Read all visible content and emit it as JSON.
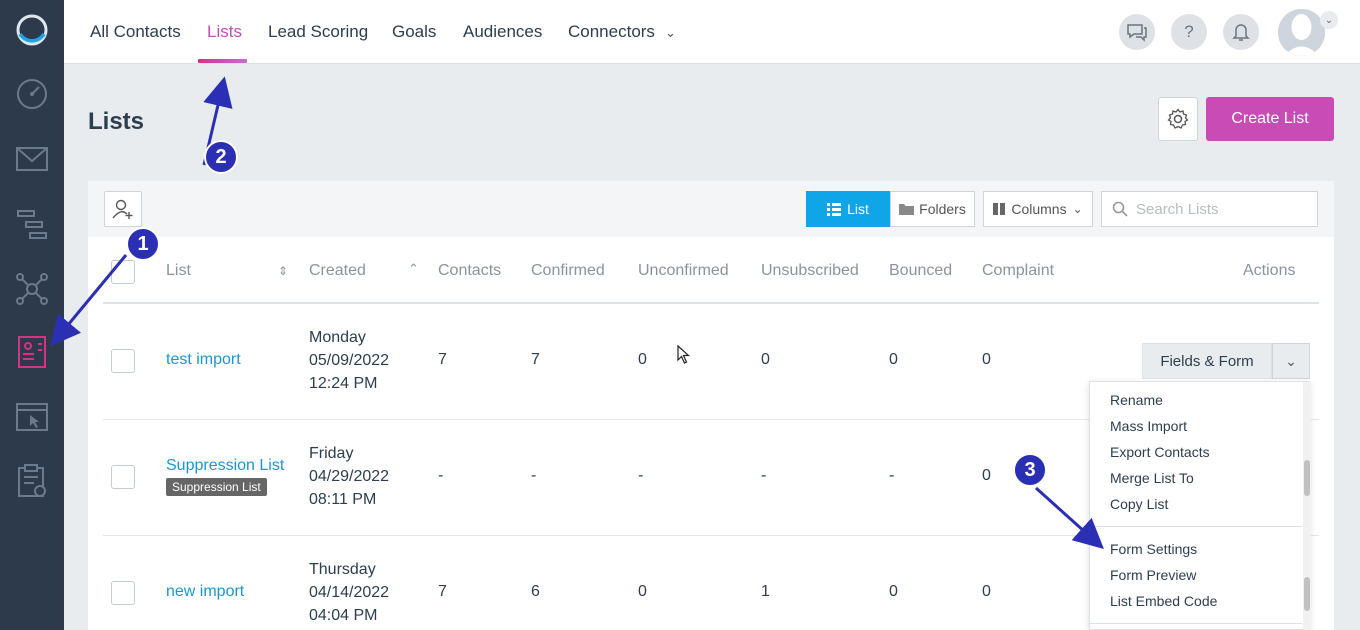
{
  "nav": {
    "items": [
      "All Contacts",
      "Lists",
      "Lead Scoring",
      "Goals",
      "Audiences",
      "Connectors"
    ],
    "active": "Lists",
    "help_label": "?"
  },
  "page": {
    "title": "Lists",
    "create_label": "Create List"
  },
  "toolbar": {
    "list_label": "List",
    "folders_label": "Folders",
    "columns_label": "Columns",
    "search_placeholder": "Search Lists"
  },
  "table": {
    "headers": [
      "List",
      "Created",
      "Contacts",
      "Confirmed",
      "Unconfirmed",
      "Unsubscribed",
      "Bounced",
      "Complaint",
      "Actions"
    ],
    "rows": [
      {
        "name": "test import",
        "badge": "",
        "day": "Monday",
        "date": "05/09/2022",
        "time": "12:24 PM",
        "contacts": "7",
        "confirmed": "7",
        "unconfirmed": "0",
        "unsubscribed": "0",
        "bounced": "0",
        "complaint": "0"
      },
      {
        "name": "Suppression List",
        "badge": "Suppression List",
        "day": "Friday",
        "date": "04/29/2022",
        "time": "08:11 PM",
        "contacts": "-",
        "confirmed": "-",
        "unconfirmed": "-",
        "unsubscribed": "-",
        "bounced": "-",
        "complaint": "0"
      },
      {
        "name": "new import",
        "badge": "",
        "day": "Thursday",
        "date": "04/14/2022",
        "time": "04:04 PM",
        "contacts": "7",
        "confirmed": "6",
        "unconfirmed": "0",
        "unsubscribed": "1",
        "bounced": "0",
        "complaint": "0"
      }
    ],
    "action_label": "Fields & Form"
  },
  "dropdown": {
    "group1": [
      "Rename",
      "Mass Import",
      "Export Contacts",
      "Merge List To",
      "Copy List"
    ],
    "group2": [
      "Form Settings",
      "Form Preview",
      "List Embed Code"
    ]
  },
  "annotations": [
    "1",
    "2",
    "3"
  ],
  "colors": {
    "sidebar": "#2c3a4b",
    "accent": "#c94bb6",
    "primary": "#0ea5e9",
    "link": "#1a96d4",
    "annotation": "#2b2fb4"
  }
}
